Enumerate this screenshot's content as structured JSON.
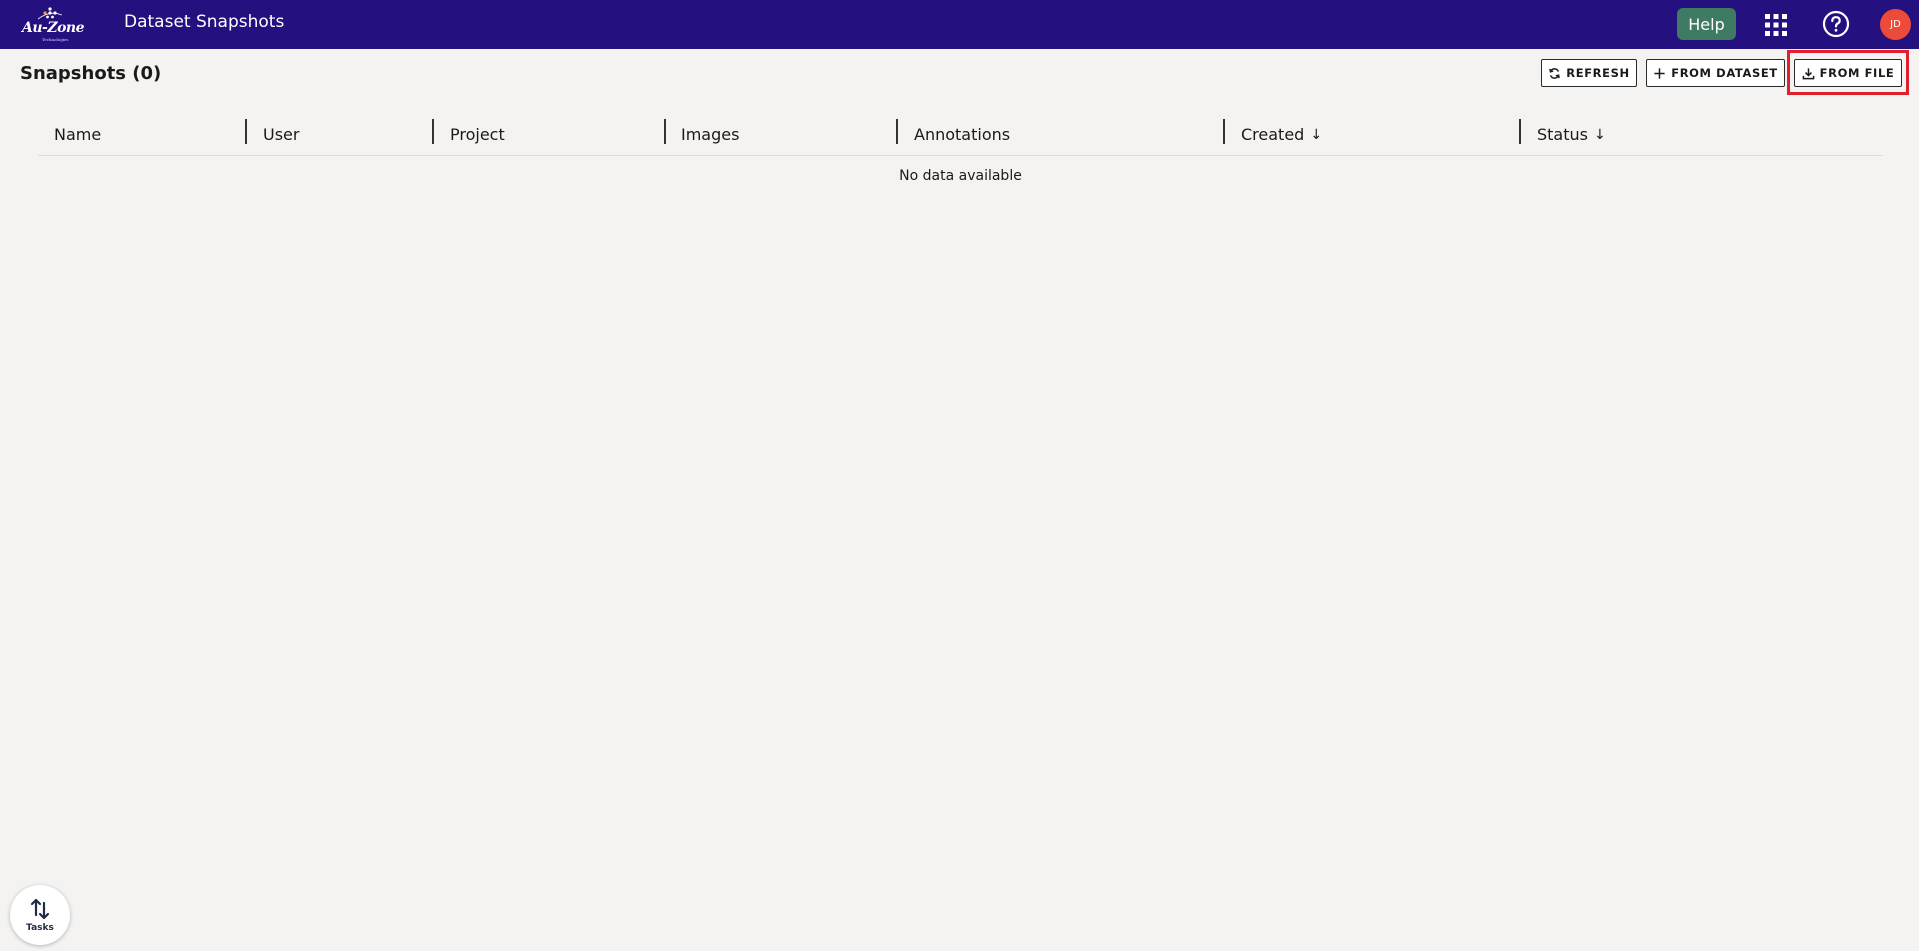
{
  "appbar": {
    "logo_text": "Au-Zone",
    "logo_sub": "Technologies",
    "title": "Dataset Snapshots",
    "help_label": "Help",
    "avatar_initials": "JD",
    "bar_color": "#24107e",
    "help_color": "#3f7a63",
    "avatar_color": "#ec4b3a"
  },
  "header": {
    "title": "Snapshots (0)"
  },
  "toolbar": {
    "refresh_label": "REFRESH",
    "from_dataset_label": "FROM DATASET",
    "from_file_label": "FROM FILE",
    "highlight_color": "#e0202a"
  },
  "table": {
    "columns": [
      {
        "label": "Name",
        "sort": ""
      },
      {
        "label": "User",
        "sort": ""
      },
      {
        "label": "Project",
        "sort": ""
      },
      {
        "label": "Images",
        "sort": ""
      },
      {
        "label": "Annotations",
        "sort": ""
      },
      {
        "label": "Created",
        "sort": "↓"
      },
      {
        "label": "Status",
        "sort": "↓"
      }
    ],
    "empty_text": "No data available"
  },
  "tasks": {
    "label": "Tasks"
  },
  "icons": {
    "refresh": "refresh-icon",
    "from_dataset": "plus-icon",
    "from_file": "download-icon",
    "apps": "apps-grid-icon",
    "help": "question-circle-icon",
    "tasks": "swap-vertical-icon"
  }
}
